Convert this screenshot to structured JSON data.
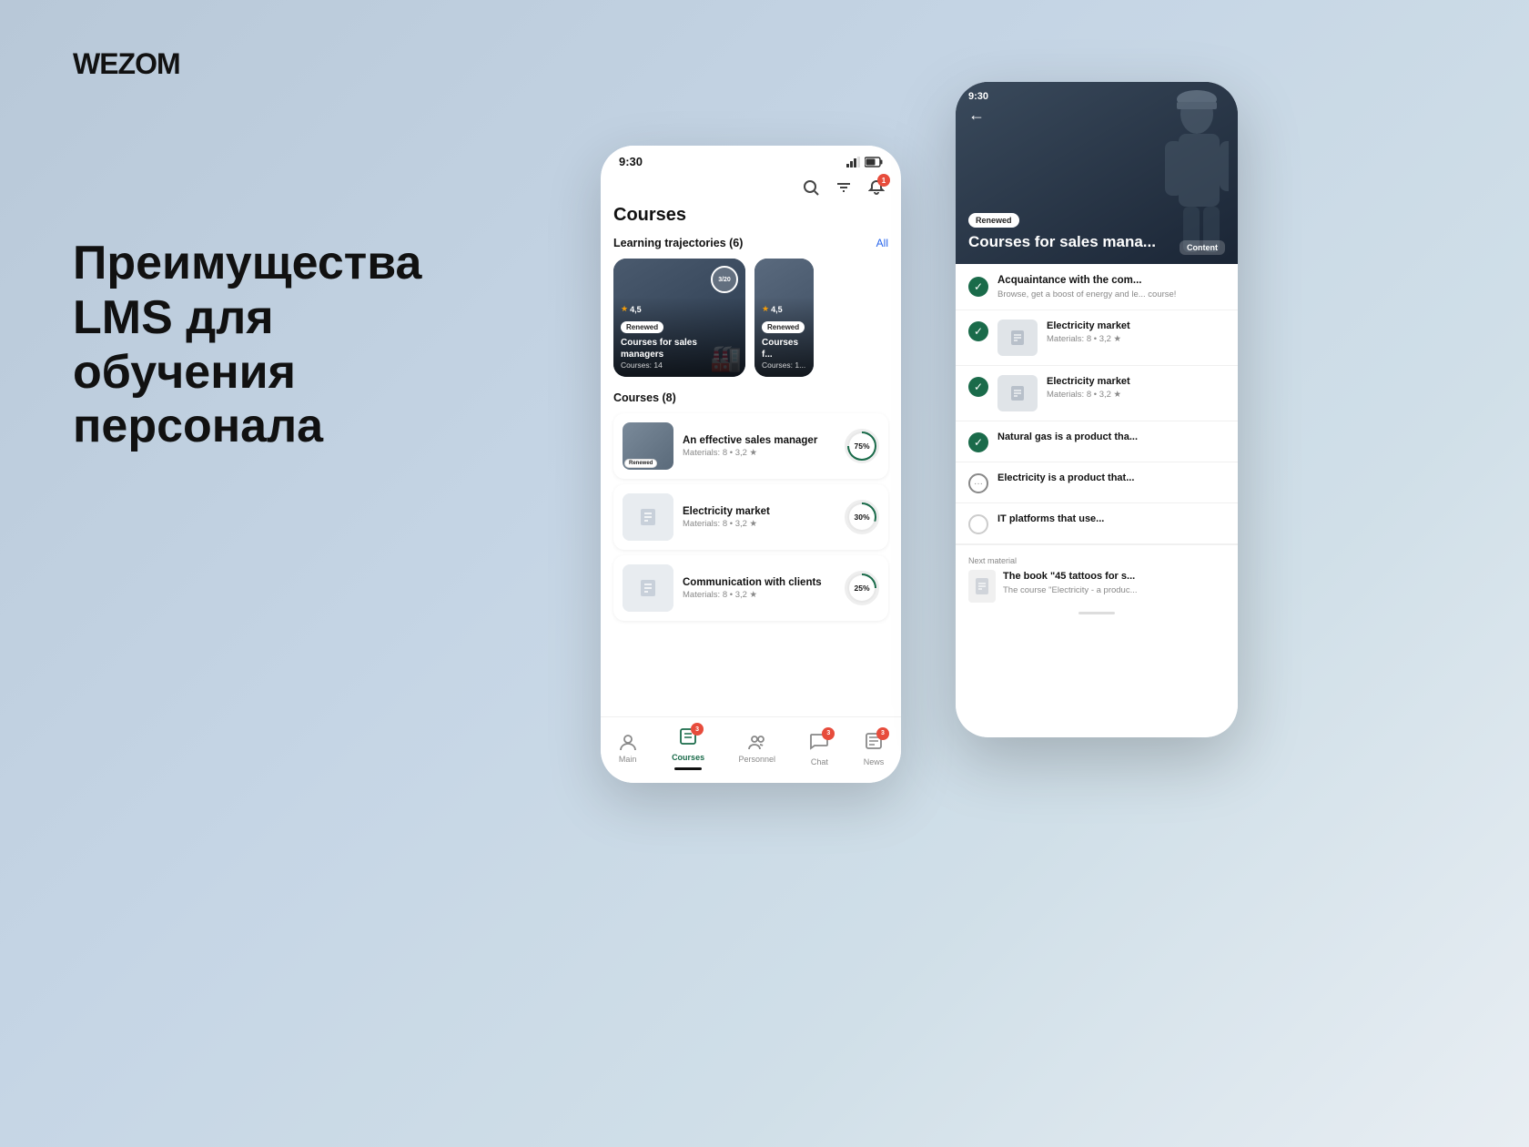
{
  "logo": "WEZOM",
  "headline": {
    "line1": "Преимущества LMS для",
    "line2": "обучения персонала"
  },
  "phone1": {
    "status_time": "9:30",
    "header_icons": {
      "search": "search",
      "filter": "filter",
      "bell": "bell",
      "bell_badge": "1"
    },
    "page_title": "Courses",
    "learning_section": {
      "label": "Learning trajectories (6)",
      "all_label": "All",
      "cards": [
        {
          "rating": "4,5",
          "badge": "Renewed",
          "title": "Courses for sales managers",
          "courses": "Courses: 14",
          "progress": "3/20"
        },
        {
          "rating": "4,5",
          "badge": "Renewed",
          "title": "Courses f...",
          "courses": "Courses: 1...",
          "progress": ""
        }
      ]
    },
    "courses_section": {
      "label": "Courses (8)",
      "items": [
        {
          "name": "An effective sales manager",
          "meta": "Materials: 8 • 3,2 ★",
          "progress": "75%",
          "badge": "Renewed",
          "has_photo": true
        },
        {
          "name": "Electricity market",
          "meta": "Materials: 8 • 3,2 ★",
          "progress": "30%",
          "badge": "",
          "has_photo": false
        },
        {
          "name": "Communication with clients",
          "meta": "Materials: 8 • 3,2 ★",
          "progress": "25%",
          "badge": "",
          "has_photo": false
        }
      ]
    },
    "bottom_nav": [
      {
        "label": "Main",
        "icon": "person",
        "active": false,
        "badge": ""
      },
      {
        "label": "Courses",
        "icon": "book",
        "active": true,
        "badge": "3"
      },
      {
        "label": "Personnel",
        "icon": "people",
        "active": false,
        "badge": ""
      },
      {
        "label": "Chat",
        "icon": "chat",
        "active": false,
        "badge": "3"
      },
      {
        "label": "News",
        "icon": "news",
        "active": false,
        "badge": "3"
      }
    ]
  },
  "phone2": {
    "status_time": "9:30",
    "back_icon": "←",
    "hero": {
      "badge": "Renewed",
      "title": "Courses for sales mana...",
      "tab": "Content"
    },
    "items": [
      {
        "type": "header",
        "title": "Acquaintance with the com...",
        "sub": "Browse, get a boost of energy and le... course!"
      },
      {
        "type": "checked",
        "thumb": true,
        "name": "Electricity market",
        "meta": "Materials: 8 • 3,2 ★"
      },
      {
        "type": "checked",
        "thumb": true,
        "name": "Electricity market",
        "meta": "Materials: 8 • 3,2 ★"
      },
      {
        "type": "checked",
        "thumb": false,
        "name": "Natural gas is a product tha...",
        "meta": ""
      },
      {
        "type": "in-progress",
        "thumb": false,
        "name": "Electricity is a product that...",
        "meta": ""
      },
      {
        "type": "empty",
        "thumb": false,
        "name": "IT platforms that use...",
        "meta": ""
      }
    ],
    "next_material": {
      "label": "Next material",
      "title": "The book \"45 tattoos for s...",
      "sub": "The course \"Electricity - a produc..."
    }
  }
}
